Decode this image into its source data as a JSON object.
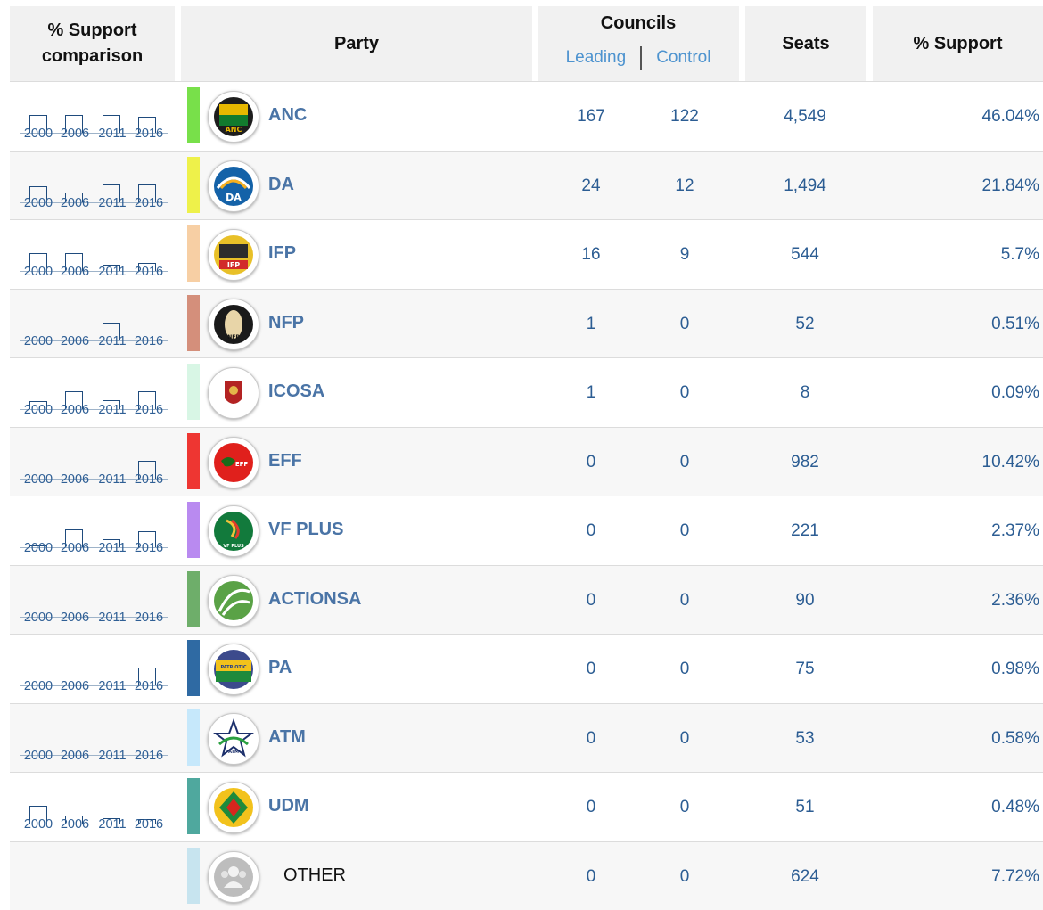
{
  "header": {
    "support_comparison": "% Support comparison",
    "party": "Party",
    "councils": "Councils",
    "leading": "Leading",
    "control": "Control",
    "seats": "Seats",
    "support": "% Support"
  },
  "years": [
    "2000",
    "2006",
    "2011",
    "2016"
  ],
  "rows": [
    {
      "name": "ANC",
      "color": "#78e04a",
      "leading": "167",
      "control": "122",
      "seats": "4,549",
      "support": "46.04%",
      "history": [
        1,
        1,
        1,
        0.9
      ],
      "logo": "anc-logo"
    },
    {
      "name": "DA",
      "color": "#eef14a",
      "leading": "24",
      "control": "12",
      "seats": "1,494",
      "support": "21.84%",
      "history": [
        0.9,
        0.55,
        1,
        1
      ],
      "logo": "da-logo"
    },
    {
      "name": "IFP",
      "color": "#f7cfa4",
      "leading": "16",
      "control": "9",
      "seats": "544",
      "support": "5.7%",
      "history": [
        1,
        1,
        0.35,
        0.45
      ],
      "logo": "ifp-logo"
    },
    {
      "name": "NFP",
      "color": "#d48f7b",
      "leading": "1",
      "control": "0",
      "seats": "52",
      "support": "0.51%",
      "history": [
        0,
        0,
        1,
        0
      ],
      "logo": "nfp-logo"
    },
    {
      "name": "ICOSA",
      "color": "#d8f6e5",
      "leading": "1",
      "control": "0",
      "seats": "8",
      "support": "0.09%",
      "history": [
        0.45,
        1,
        0.5,
        1
      ],
      "logo": "icosa-logo"
    },
    {
      "name": "EFF",
      "color": "#ee3632",
      "leading": "0",
      "control": "0",
      "seats": "982",
      "support": "10.42%",
      "history": [
        0,
        0,
        0,
        1
      ],
      "logo": "eff-logo"
    },
    {
      "name": "VF PLUS",
      "color": "#b98af0",
      "leading": "0",
      "control": "0",
      "seats": "221",
      "support": "2.37%",
      "history": [
        0.1,
        1,
        0.45,
        0.9
      ],
      "logo": "vfplus-logo"
    },
    {
      "name": "ACTIONSA",
      "color": "#6eae6a",
      "leading": "0",
      "control": "0",
      "seats": "90",
      "support": "2.36%",
      "history": [
        0,
        0,
        0,
        0
      ],
      "logo": "actionsa-logo"
    },
    {
      "name": "PA",
      "color": "#2f6aa3",
      "leading": "0",
      "control": "0",
      "seats": "75",
      "support": "0.98%",
      "history": [
        0,
        0,
        0,
        1
      ],
      "logo": "pa-logo"
    },
    {
      "name": "ATM",
      "color": "#c6e8fb",
      "leading": "0",
      "control": "0",
      "seats": "53",
      "support": "0.58%",
      "history": [
        0,
        0,
        0,
        0
      ],
      "logo": "atm-logo"
    },
    {
      "name": "UDM",
      "color": "#4fa89e",
      "leading": "0",
      "control": "0",
      "seats": "51",
      "support": "0.48%",
      "history": [
        1,
        0.45,
        0.3,
        0.25
      ],
      "logo": "udm-logo"
    },
    {
      "name": "OTHER",
      "color": "#c7e4ef",
      "leading": "0",
      "control": "0",
      "seats": "624",
      "support": "7.72%",
      "history": null,
      "logo": "group-icon"
    }
  ]
}
